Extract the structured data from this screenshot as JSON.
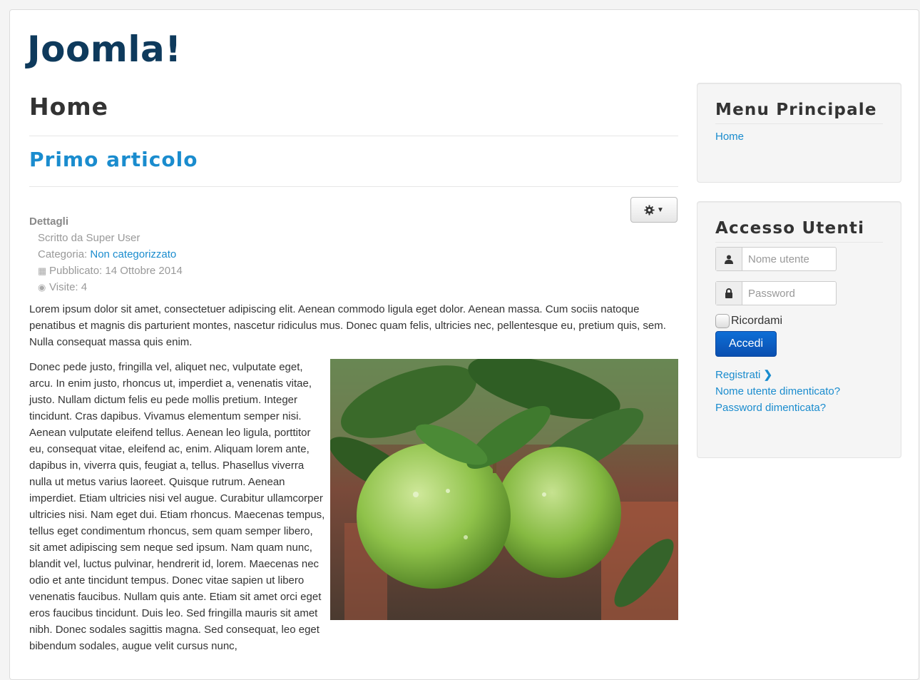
{
  "site": {
    "brand": "Joomla!"
  },
  "page": {
    "heading": "Home"
  },
  "article": {
    "title": "Primo articolo",
    "tools_icon": "gear-icon",
    "details": {
      "label": "Dettagli",
      "author": "Scritto da Super User",
      "category_label": "Categoria: ",
      "category_value": "Non categorizzato",
      "published": "Pubblicato: 14 Ottobre 2014",
      "hits": "Visite: 4"
    },
    "intro": "Lorem ipsum dolor sit amet, consectetuer adipiscing elit. Aenean commodo ligula eget dolor. Aenean massa. Cum sociis natoque penatibus et magnis dis parturient montes, nascetur ridiculus mus. Donec quam felis, ultricies nec, pellentesque eu, pretium quis, sem. Nulla consequat massa quis enim.",
    "body": "Donec pede justo, fringilla vel, aliquet nec, vulputate eget, arcu. In enim justo, rhoncus ut, imperdiet a, venenatis vitae, justo. Nullam dictum felis eu pede mollis pretium. Integer tincidunt. Cras dapibus. Vivamus elementum semper nisi. Aenean vulputate eleifend tellus. Aenean leo ligula, porttitor eu, consequat vitae, eleifend ac, enim. Aliquam lorem ante, dapibus in, viverra quis, feugiat a, tellus. Phasellus viverra nulla ut metus varius laoreet. Quisque rutrum. Aenean imperdiet. Etiam ultricies nisi vel augue. Curabitur ullamcorper ultricies nisi. Nam eget dui. Etiam rhoncus. Maecenas tempus, tellus eget condimentum rhoncus, sem quam semper libero, sit amet adipiscing sem neque sed ipsum. Nam quam nunc, blandit vel, luctus pulvinar, hendrerit id, lorem. Maecenas nec odio et ante tincidunt tempus. Donec vitae sapien ut libero venenatis faucibus. Nullam quis ante. Etiam sit amet orci eget eros faucibus tincidunt. Duis leo. Sed fringilla mauris sit amet nibh. Donec sodales sagittis magna. Sed consequat, leo eget bibendum sodales, augue velit cursus nunc,"
  },
  "sidebar": {
    "menu": {
      "title": "Menu Principale",
      "items": [
        "Home"
      ]
    },
    "login": {
      "title": "Accesso Utenti",
      "username_placeholder": "Nome utente",
      "password_placeholder": "Password",
      "remember_label": "Ricordami",
      "submit_label": "Accedi",
      "register_label": "Registrati",
      "forgot_username": "Nome utente dimenticato?",
      "forgot_password": "Password dimenticata?"
    }
  },
  "colors": {
    "brand": "#0e3a5c",
    "link": "#1a8cce",
    "button_primary": "#0a4fb0"
  }
}
